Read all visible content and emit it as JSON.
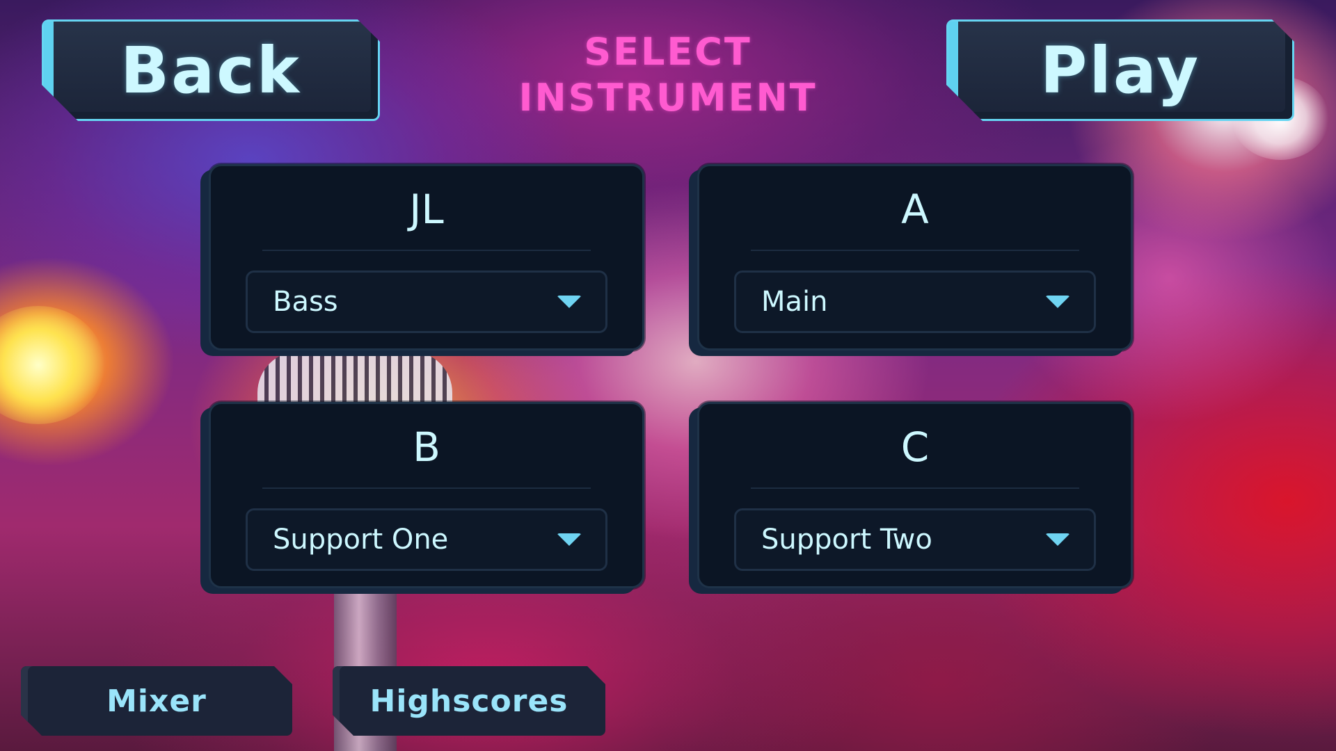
{
  "header": {
    "back_label": "Back",
    "play_label": "Play",
    "title_line1": "SELECT",
    "title_line2": "INSTRUMENT"
  },
  "players": [
    {
      "name": "JL",
      "instrument": "Bass"
    },
    {
      "name": "A",
      "instrument": "Main"
    },
    {
      "name": "B",
      "instrument": "Support One"
    },
    {
      "name": "C",
      "instrument": "Support Two"
    }
  ],
  "footer": {
    "mixer_label": "Mixer",
    "highscores_label": "Highscores"
  },
  "colors": {
    "title": "#ff5bd0",
    "button_text": "#cdf8ff",
    "accent": "#66d5f2",
    "panel": "#0b1524"
  },
  "icons": {
    "dropdown": "chevron-down-icon"
  }
}
